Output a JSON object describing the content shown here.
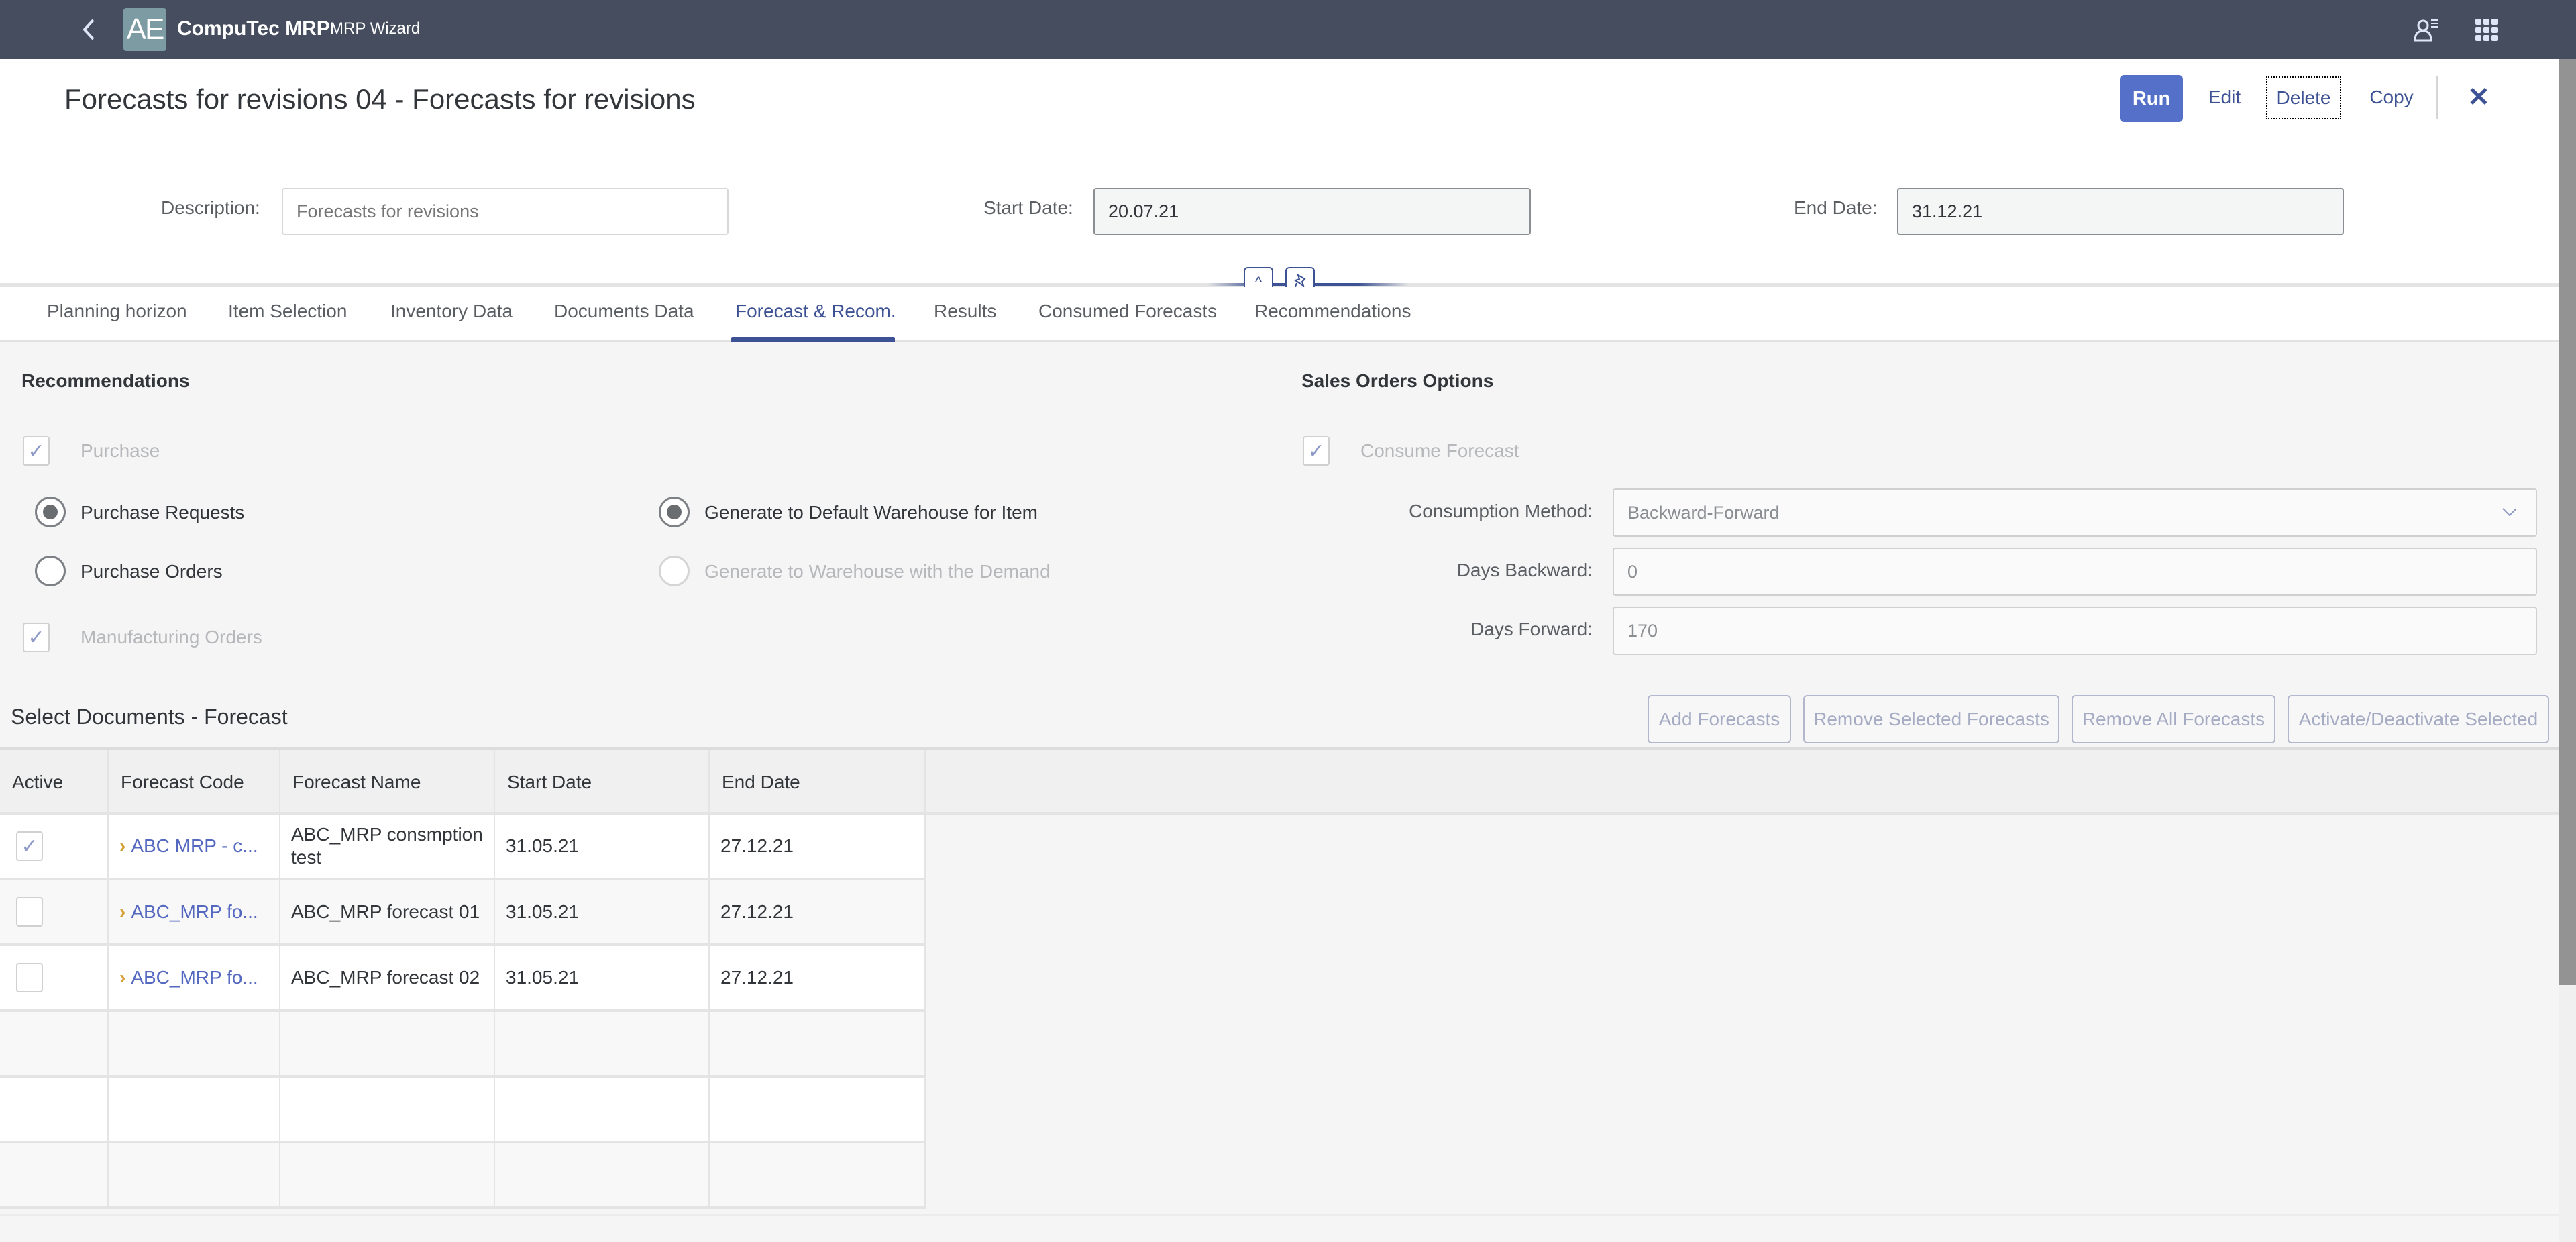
{
  "shell": {
    "app_name": "CompuTec MRP",
    "app_subtitle": "MRP Wizard",
    "logo_text": "AE",
    "icons": {
      "back": "chevron-left-icon",
      "user": "user-settings-icon",
      "apps": "app-grid-icon"
    }
  },
  "header": {
    "title": "Forecasts for revisions 04 - Forecasts for revisions",
    "actions": {
      "run": "Run",
      "edit": "Edit",
      "delete": "Delete",
      "copy": "Copy",
      "close": "✕"
    },
    "fields": {
      "description": {
        "label": "Description:",
        "value": "",
        "placeholder": "Forecasts for revisions"
      },
      "start_date": {
        "label": "Start Date:",
        "value": "20.07.21"
      },
      "end_date": {
        "label": "End Date:",
        "value": "31.12.21"
      }
    },
    "collapse_icon": "^",
    "pin_icon": "📌"
  },
  "tabs": [
    {
      "label": "Planning horizon",
      "active": false
    },
    {
      "label": "Item Selection",
      "active": false
    },
    {
      "label": "Inventory Data",
      "active": false
    },
    {
      "label": "Documents Data",
      "active": false
    },
    {
      "label": "Forecast & Recom.",
      "active": true
    },
    {
      "label": "Results",
      "active": false
    },
    {
      "label": "Consumed Forecasts",
      "active": false
    },
    {
      "label": "Recommendations",
      "active": false
    }
  ],
  "recommendations": {
    "title": "Recommendations",
    "purchase": {
      "label": "Purchase",
      "checked": true,
      "disabled": true
    },
    "purchase_requests": {
      "label": "Purchase Requests",
      "selected": true
    },
    "purchase_orders": {
      "label": "Purchase Orders",
      "selected": false
    },
    "default_warehouse": {
      "label": "Generate to Default Warehouse for Item",
      "selected": true
    },
    "demand_warehouse": {
      "label": "Generate to Warehouse with the Demand",
      "selected": false,
      "disabled": true
    },
    "manufacturing_orders": {
      "label": "Manufacturing Orders",
      "checked": true,
      "disabled": true
    },
    "check_glyph": "✓"
  },
  "sales_orders": {
    "title": "Sales Orders Options",
    "consume_forecast": {
      "label": "Consume Forecast",
      "checked": true,
      "disabled": true
    },
    "consumption_method": {
      "label": "Consumption Method:",
      "value": "Backward-Forward"
    },
    "days_backward": {
      "label": "Days Backward:",
      "value": "0"
    },
    "days_forward": {
      "label": "Days Forward:",
      "value": "170"
    },
    "dropdown_glyph": "⌄"
  },
  "documents": {
    "title": "Select Documents - Forecast",
    "buttons": {
      "add": "Add Forecasts",
      "remove_selected": "Remove Selected Forecasts",
      "remove_all": "Remove All Forecasts",
      "toggle_active": "Activate/Deactivate Selected"
    },
    "columns": [
      "Active",
      "Forecast Code",
      "Forecast Name",
      "Start Date",
      "End Date"
    ],
    "rows": [
      {
        "active": true,
        "active_glyph": "✓",
        "code": "ABC MRP - c...",
        "name": "ABC_MRP consmption test",
        "start": "31.05.21",
        "end": "27.12.21"
      },
      {
        "active": false,
        "active_glyph": "",
        "code": "ABC_MRP fo...",
        "name": "ABC_MRP forecast 01",
        "start": "31.05.21",
        "end": "27.12.21"
      },
      {
        "active": false,
        "active_glyph": "",
        "code": "ABC_MRP fo...",
        "name": "ABC_MRP forecast 02",
        "start": "31.05.21",
        "end": "27.12.21"
      }
    ],
    "expander_glyph": "›"
  }
}
